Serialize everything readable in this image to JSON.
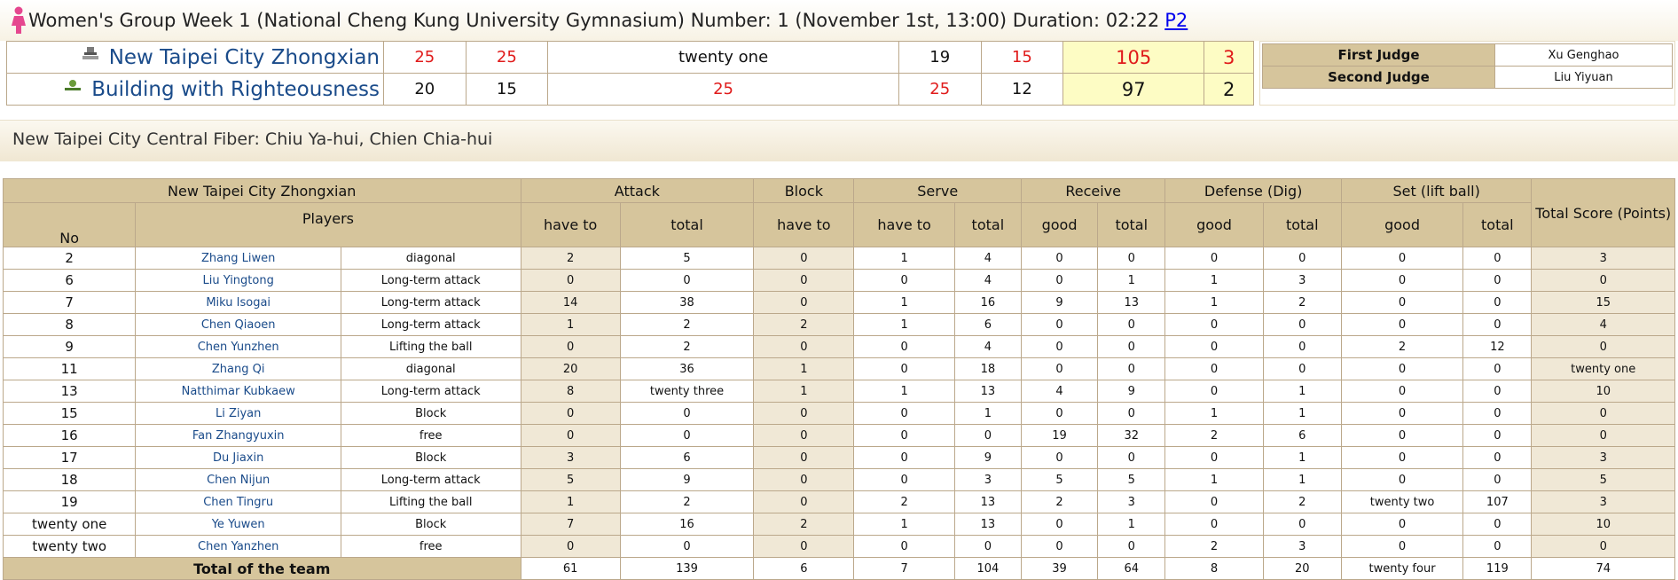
{
  "header": {
    "title": "Women's Group Week 1 (National Cheng Kung University Gymnasium) Number: 1 (November 1st, 13:00) Duration: 02:22",
    "link": "P2"
  },
  "score": {
    "teams": [
      {
        "name": "New Taipei City Zhongxian",
        "sets": [
          "25",
          "25",
          "twenty one",
          "19",
          "15"
        ],
        "total": "105",
        "sets_won": "3"
      },
      {
        "name": "Building with Righteousness",
        "sets": [
          "20",
          "15",
          "25",
          "25",
          "12"
        ],
        "total": "97",
        "sets_won": "2"
      }
    ]
  },
  "judges": {
    "first_label": "First Judge",
    "first_name": "Xu Genghao",
    "second_label": "Second Judge",
    "second_name": "Liu Yiyuan"
  },
  "coach_line": "New Taipei City Central Fiber: Chiu Ya-hui, Chien Chia-hui",
  "stats": {
    "team_header": "New Taipei City Zhongxian",
    "groups": {
      "attack": "Attack",
      "block": "Block",
      "serve": "Serve",
      "receive": "Receive",
      "defense": "Defense (Dig)",
      "set": "Set (lift ball)",
      "total_score": "Total Score (Points)"
    },
    "sub": {
      "no": "No",
      "players": "Players",
      "attack_have": "have to",
      "attack_total": "total",
      "block_have": "have to",
      "serve_have": "have to",
      "serve_total": "total",
      "receive_good": "good",
      "receive_total": "total",
      "defense_good": "good",
      "defense_total": "total",
      "set_good": "good",
      "set_total": "total"
    },
    "rows": [
      {
        "no": "2",
        "name": "Zhang Liwen",
        "pos": "diagonal",
        "ah": "2",
        "at": "5",
        "bh": "0",
        "sh": "1",
        "st": "4",
        "rg": "0",
        "rt": "0",
        "dg": "0",
        "dt": "0",
        "lg": "0",
        "lt": "0",
        "pts": "3"
      },
      {
        "no": "6",
        "name": "Liu Yingtong",
        "pos": "Long-term attack",
        "ah": "0",
        "at": "0",
        "bh": "0",
        "sh": "0",
        "st": "4",
        "rg": "0",
        "rt": "1",
        "dg": "1",
        "dt": "3",
        "lg": "0",
        "lt": "0",
        "pts": "0"
      },
      {
        "no": "7",
        "name": "Miku Isogai",
        "pos": "Long-term attack",
        "ah": "14",
        "at": "38",
        "bh": "0",
        "sh": "1",
        "st": "16",
        "rg": "9",
        "rt": "13",
        "dg": "1",
        "dt": "2",
        "lg": "0",
        "lt": "0",
        "pts": "15"
      },
      {
        "no": "8",
        "name": "Chen Qiaoen",
        "pos": "Long-term attack",
        "ah": "1",
        "at": "2",
        "bh": "2",
        "sh": "1",
        "st": "6",
        "rg": "0",
        "rt": "0",
        "dg": "0",
        "dt": "0",
        "lg": "0",
        "lt": "0",
        "pts": "4"
      },
      {
        "no": "9",
        "name": "Chen Yunzhen",
        "pos": "Lifting the ball",
        "ah": "0",
        "at": "2",
        "bh": "0",
        "sh": "0",
        "st": "4",
        "rg": "0",
        "rt": "0",
        "dg": "0",
        "dt": "0",
        "lg": "2",
        "lt": "12",
        "pts": "0"
      },
      {
        "no": "11",
        "name": "Zhang Qi",
        "pos": "diagonal",
        "ah": "20",
        "at": "36",
        "bh": "1",
        "sh": "0",
        "st": "18",
        "rg": "0",
        "rt": "0",
        "dg": "0",
        "dt": "0",
        "lg": "0",
        "lt": "0",
        "pts": "twenty one"
      },
      {
        "no": "13",
        "name": "Natthimar Kubkaew",
        "pos": "Long-term attack",
        "ah": "8",
        "at": "twenty three",
        "bh": "1",
        "sh": "1",
        "st": "13",
        "rg": "4",
        "rt": "9",
        "dg": "0",
        "dt": "1",
        "lg": "0",
        "lt": "0",
        "pts": "10"
      },
      {
        "no": "15",
        "name": "Li Ziyan",
        "pos": "Block",
        "ah": "0",
        "at": "0",
        "bh": "0",
        "sh": "0",
        "st": "1",
        "rg": "0",
        "rt": "0",
        "dg": "1",
        "dt": "1",
        "lg": "0",
        "lt": "0",
        "pts": "0"
      },
      {
        "no": "16",
        "name": "Fan Zhangyuxin",
        "pos": "free",
        "ah": "0",
        "at": "0",
        "bh": "0",
        "sh": "0",
        "st": "0",
        "rg": "19",
        "rt": "32",
        "dg": "2",
        "dt": "6",
        "lg": "0",
        "lt": "0",
        "pts": "0"
      },
      {
        "no": "17",
        "name": "Du Jiaxin",
        "pos": "Block",
        "ah": "3",
        "at": "6",
        "bh": "0",
        "sh": "0",
        "st": "9",
        "rg": "0",
        "rt": "0",
        "dg": "0",
        "dt": "1",
        "lg": "0",
        "lt": "0",
        "pts": "3"
      },
      {
        "no": "18",
        "name": "Chen Nijun",
        "pos": "Long-term attack",
        "ah": "5",
        "at": "9",
        "bh": "0",
        "sh": "0",
        "st": "3",
        "rg": "5",
        "rt": "5",
        "dg": "1",
        "dt": "1",
        "lg": "0",
        "lt": "0",
        "pts": "5"
      },
      {
        "no": "19",
        "name": "Chen Tingru",
        "pos": "Lifting the ball",
        "ah": "1",
        "at": "2",
        "bh": "0",
        "sh": "2",
        "st": "13",
        "rg": "2",
        "rt": "3",
        "dg": "0",
        "dt": "2",
        "lg": "twenty two",
        "lt": "107",
        "pts": "3"
      },
      {
        "no": "twenty one",
        "name": "Ye Yuwen",
        "pos": "Block",
        "ah": "7",
        "at": "16",
        "bh": "2",
        "sh": "1",
        "st": "13",
        "rg": "0",
        "rt": "1",
        "dg": "0",
        "dt": "0",
        "lg": "0",
        "lt": "0",
        "pts": "10"
      },
      {
        "no": "twenty two",
        "name": "Chen Yanzhen",
        "pos": "free",
        "ah": "0",
        "at": "0",
        "bh": "0",
        "sh": "0",
        "st": "0",
        "rg": "0",
        "rt": "0",
        "dg": "2",
        "dt": "3",
        "lg": "0",
        "lt": "0",
        "pts": "0"
      }
    ],
    "total_row": {
      "label": "Total of the team",
      "ah": "61",
      "at": "139",
      "bh": "6",
      "sh": "7",
      "st": "104",
      "rg": "39",
      "rt": "64",
      "dg": "8",
      "dt": "20",
      "lg": "twenty four",
      "lt": "119",
      "pts": "74"
    }
  }
}
